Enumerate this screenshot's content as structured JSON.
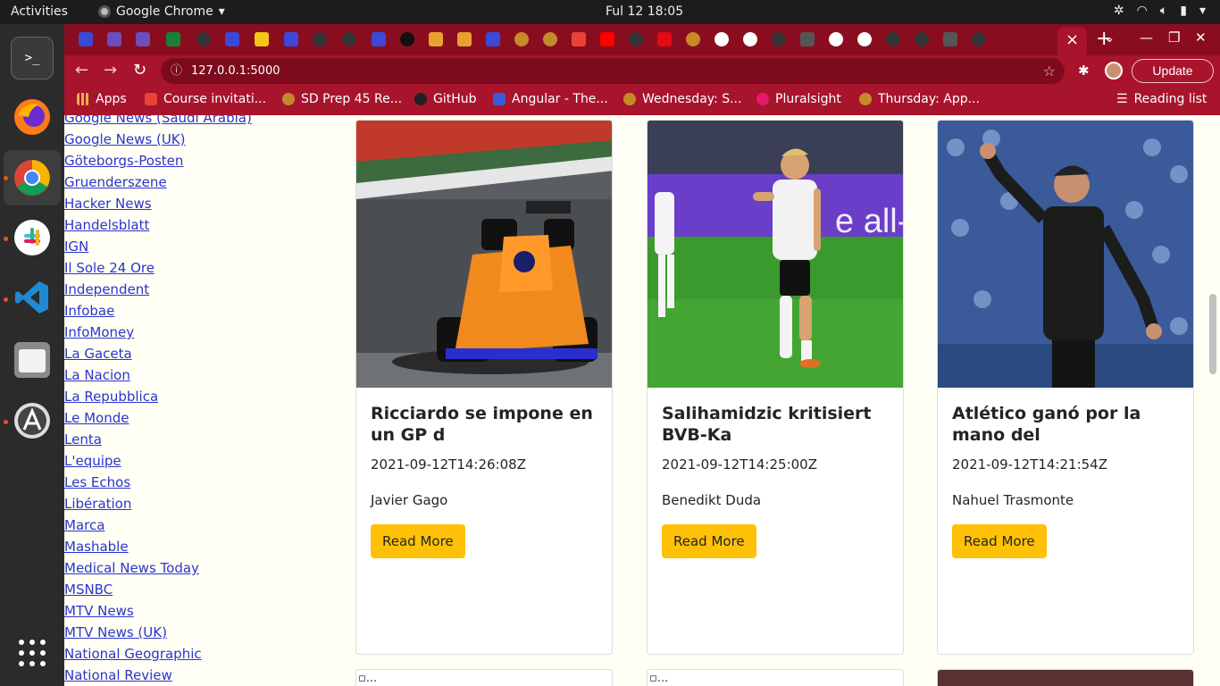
{
  "topbar": {
    "activities": "Activities",
    "app_name": "Google Chrome",
    "clock": "Ful 12  18:05"
  },
  "tabs": {
    "close_glyph": "×",
    "new_glyph": "+"
  },
  "toolbar": {
    "url": "127.0.0.1:5000",
    "update_label": "Update"
  },
  "bookmarks": {
    "items": [
      {
        "label": "Apps",
        "color": "#e8b04a"
      },
      {
        "label": "Course invitati...",
        "color": "#ea4335"
      },
      {
        "label": "SD Prep 45 Re...",
        "color": "#c48a2a"
      },
      {
        "label": "GitHub",
        "color": "#222222"
      },
      {
        "label": "Angular - The...",
        "color": "#3b5bdb"
      },
      {
        "label": "Wednesday: S...",
        "color": "#c48a2a"
      },
      {
        "label": "Pluralsight",
        "color": "#e5186b"
      },
      {
        "label": "Thursday: App...",
        "color": "#c48a2a"
      }
    ],
    "reading_list": "Reading list"
  },
  "sources": [
    "Google News (Saudi Arabia)",
    "Google News (UK)",
    "Göteborgs-Posten",
    "Gruenderszene",
    "Hacker News",
    "Handelsblatt",
    "IGN",
    "Il Sole 24 Ore",
    "Independent",
    "Infobae",
    "InfoMoney",
    "La Gaceta",
    "La Nacion",
    "La Repubblica",
    "Le Monde",
    "Lenta",
    "L'equipe",
    "Les Echos",
    "Libération",
    "Marca",
    "Mashable",
    "Medical News Today",
    "MSNBC",
    "MTV News",
    "MTV News (UK)",
    "National Geographic",
    "National Review"
  ],
  "articles": [
    {
      "title": "Ricciardo se impone en un GP d",
      "date": "2021-09-12T14:26:08Z",
      "author": "Javier Gago",
      "button": "Read More"
    },
    {
      "title": "Salihamidzic kritisiert BVB-Ka",
      "date": "2021-09-12T14:25:00Z",
      "author": "Benedikt Duda",
      "button": "Read More"
    },
    {
      "title": "Atlético ganó por la mano del",
      "date": "2021-09-12T14:21:54Z",
      "author": "Nahuel Trasmonte",
      "button": "Read More"
    }
  ],
  "next_row_alt": [
    "...",
    "..."
  ],
  "colors": {
    "chrome_theme": "#a8142c",
    "tab_strip": "#8a0d1f",
    "read_more": "#ffc107",
    "page_bg": "#fffff5",
    "link": "#2b35cc"
  }
}
